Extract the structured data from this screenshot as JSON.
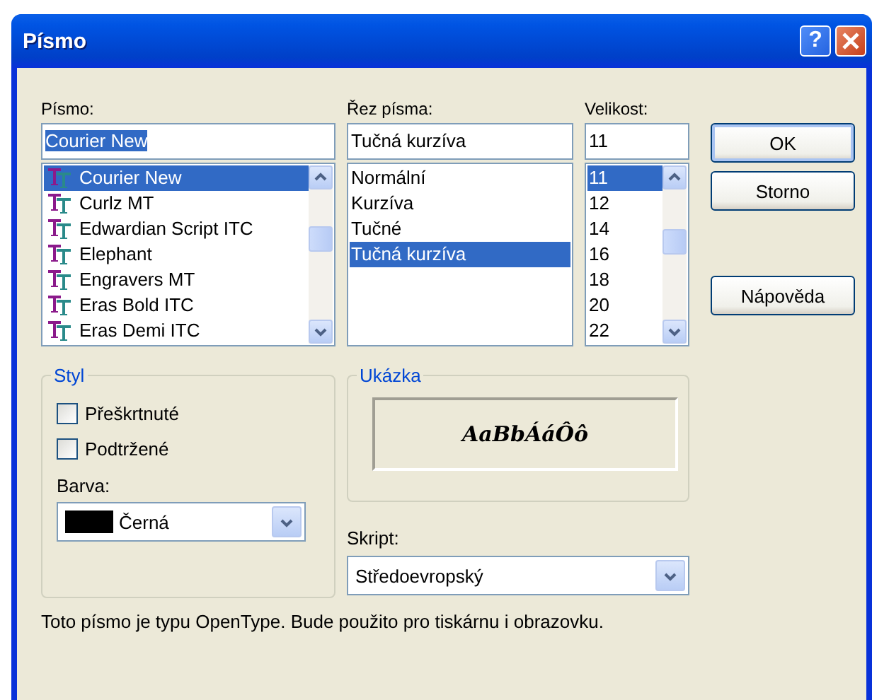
{
  "window": {
    "title": "Písmo",
    "controls": [
      {
        "kind": "help",
        "label": "?"
      },
      {
        "kind": "close"
      }
    ]
  },
  "font": {
    "label": "Písmo:",
    "value": "Courier New",
    "value_selected": true,
    "items": [
      {
        "name": "Courier New",
        "selected": true
      },
      {
        "name": "Curlz MT",
        "selected": false
      },
      {
        "name": "Edwardian Script ITC",
        "selected": false
      },
      {
        "name": "Elephant",
        "selected": false
      },
      {
        "name": "Engravers MT",
        "selected": false
      },
      {
        "name": "Eras Bold ITC",
        "selected": false
      },
      {
        "name": "Eras Demi ITC",
        "selected": false
      }
    ]
  },
  "font_style": {
    "label": "Řez písma:",
    "value": "Tučná kurzíva",
    "value_selected": false,
    "items": [
      {
        "name": "Normální",
        "selected": false
      },
      {
        "name": "Kurzíva",
        "selected": false
      },
      {
        "name": "Tučné",
        "selected": false
      },
      {
        "name": "Tučná kurzíva",
        "selected": true
      }
    ]
  },
  "size": {
    "label": "Velikost:",
    "value": "11",
    "value_selected": false,
    "items": [
      {
        "name": "11",
        "selected": true
      },
      {
        "name": "12",
        "selected": false
      },
      {
        "name": "14",
        "selected": false
      },
      {
        "name": "16",
        "selected": false
      },
      {
        "name": "18",
        "selected": false
      },
      {
        "name": "20",
        "selected": false
      },
      {
        "name": "22",
        "selected": false
      }
    ]
  },
  "buttons": [
    {
      "label": "OK",
      "default": true
    },
    {
      "label": "Storno",
      "default": false
    },
    {
      "label": "Nápověda",
      "default": false
    }
  ],
  "effects": {
    "title": "Styl",
    "checkboxes": [
      {
        "label": "Přeškrtnuté",
        "checked": false
      },
      {
        "label": "Podtržené",
        "checked": false
      }
    ],
    "color": {
      "label": "Barva:",
      "value": "Černá",
      "color": "#000000"
    }
  },
  "sample": {
    "title": "Ukázka",
    "text": "AaBbÁáÔô"
  },
  "script": {
    "label": "Skript:",
    "value": "Středoevropský"
  },
  "description": "Toto písmo je typu OpenType. Bude použito pro tiskárnu i obrazovku."
}
